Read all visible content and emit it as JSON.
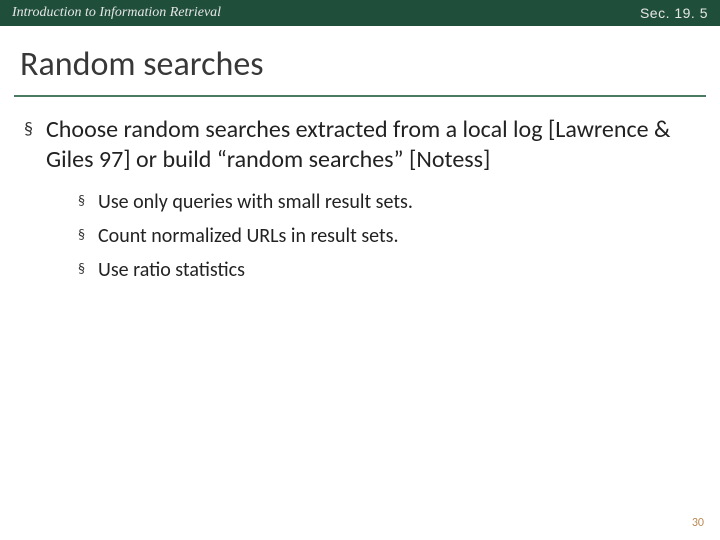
{
  "header": {
    "course": "Introduction to Information Retrieval",
    "section": "Sec. 19. 5"
  },
  "title": "Random searches",
  "bullets": {
    "main": "Choose random searches extracted from a local log [Lawrence & Giles 97] or build “random searches” [Notess]",
    "sub": [
      "Use only queries with small result sets.",
      "Count normalized URLs in result sets.",
      "Use ratio statistics"
    ]
  },
  "page_number": "30",
  "glyphs": {
    "square": "§"
  }
}
